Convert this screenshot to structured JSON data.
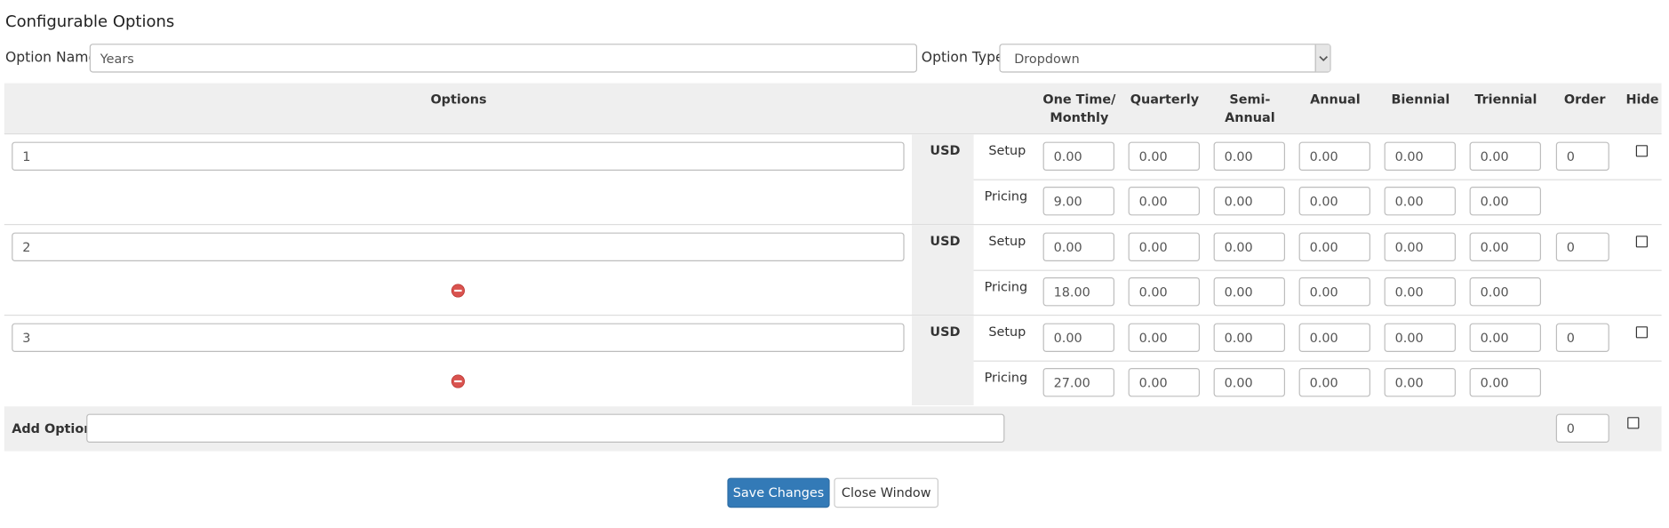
{
  "page": {
    "title": "Configurable Options"
  },
  "option_name": {
    "label": "Option Name:",
    "value": "Years"
  },
  "option_type": {
    "label": "Option Type:",
    "selected": "Dropdown"
  },
  "table": {
    "headers": {
      "options": "Options",
      "monthly_line1": "One Time/",
      "monthly_line2": "Monthly",
      "quarterly": "Quarterly",
      "semi_line1": "Semi-",
      "semi_line2": "Annual",
      "annual": "Annual",
      "biennial": "Biennial",
      "triennial": "Triennial",
      "order": "Order",
      "hide": "Hide"
    },
    "currency": "USD",
    "setup_label": "Setup",
    "pricing_label": "Pricing",
    "rows": [
      {
        "name": "1",
        "setup": [
          "0.00",
          "0.00",
          "0.00",
          "0.00",
          "0.00",
          "0.00"
        ],
        "pricing": [
          "9.00",
          "0.00",
          "0.00",
          "0.00",
          "0.00",
          "0.00"
        ],
        "order": "0"
      },
      {
        "name": "2",
        "setup": [
          "0.00",
          "0.00",
          "0.00",
          "0.00",
          "0.00",
          "0.00"
        ],
        "pricing": [
          "18.00",
          "0.00",
          "0.00",
          "0.00",
          "0.00",
          "0.00"
        ],
        "order": "0"
      },
      {
        "name": "3",
        "setup": [
          "0.00",
          "0.00",
          "0.00",
          "0.00",
          "0.00",
          "0.00"
        ],
        "pricing": [
          "27.00",
          "0.00",
          "0.00",
          "0.00",
          "0.00",
          "0.00"
        ],
        "order": "0"
      }
    ]
  },
  "add_option": {
    "label": "Add Option:",
    "value": "",
    "order": "0"
  },
  "buttons": {
    "save": "Save Changes",
    "close": "Close Window"
  },
  "colors": {
    "primary_button": "#337ab7",
    "band_gray": "#efefef",
    "remove_icon": "#d9534f"
  },
  "icons": {
    "remove": "remove-circle-icon",
    "dropdown": "chevron-down-icon"
  }
}
